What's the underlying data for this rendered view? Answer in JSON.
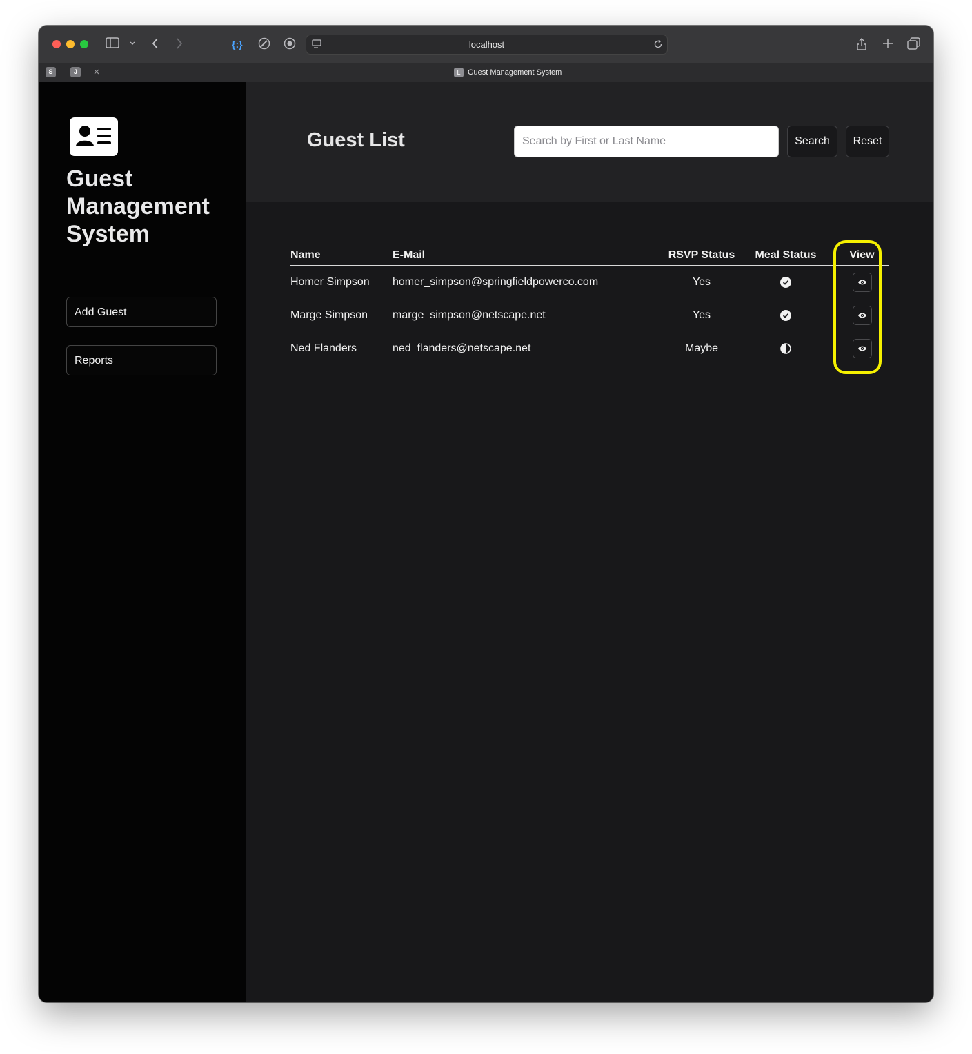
{
  "browser": {
    "url": "localhost",
    "pinned_tabs": [
      "S",
      "J"
    ],
    "tab": {
      "favicon_letter": "L",
      "title": "Guest Management System"
    }
  },
  "sidebar": {
    "title": "Guest Management System",
    "buttons": [
      {
        "label": "Add Guest"
      },
      {
        "label": "Reports"
      }
    ]
  },
  "header": {
    "title": "Guest List",
    "search_placeholder": "Search by First or Last Name",
    "search_button": "Search",
    "reset_button": "Reset"
  },
  "table": {
    "columns": [
      "Name",
      "E-Mail",
      "RSVP Status",
      "Meal Status",
      "View"
    ],
    "rows": [
      {
        "name": "Homer Simpson",
        "email": "homer_simpson@springfieldpowerco.com",
        "rsvp": "Yes",
        "meal_icon": "check-circle-icon"
      },
      {
        "name": "Marge Simpson",
        "email": "marge_simpson@netscape.net",
        "rsvp": "Yes",
        "meal_icon": "check-circle-icon"
      },
      {
        "name": "Ned Flanders",
        "email": "ned_flanders@netscape.net",
        "rsvp": "Maybe",
        "meal_icon": "half-circle-icon"
      }
    ]
  },
  "colors": {
    "highlight": "#f5f000",
    "sidebar_bg": "#040404",
    "main_bg": "#18181a",
    "header_bg": "#222224"
  }
}
